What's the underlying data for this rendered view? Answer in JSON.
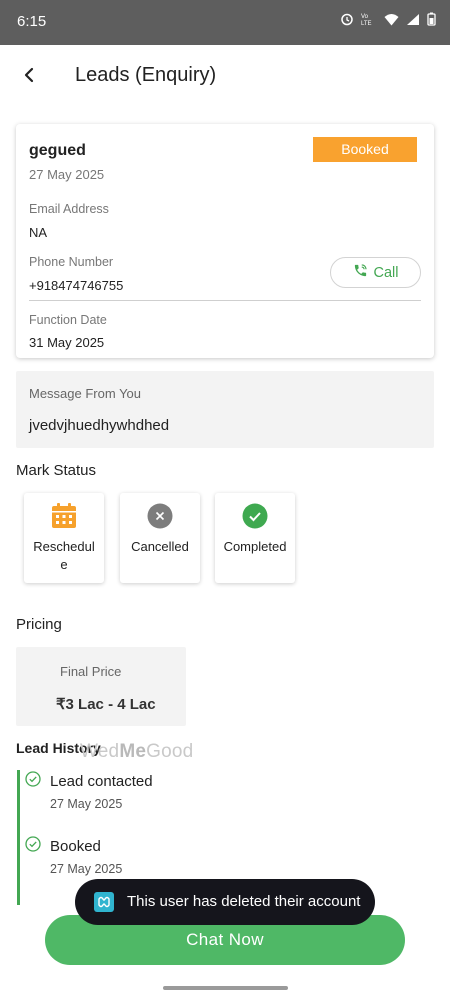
{
  "status_bar": {
    "time": "6:15"
  },
  "header": {
    "title": "Leads (Enquiry)"
  },
  "lead": {
    "name": "gegued",
    "date": "27 May 2025",
    "badge": "Booked",
    "email_label": "Email Address",
    "email_value": "NA",
    "phone_label": "Phone Number",
    "phone_value": "+918474746755",
    "call_label": "Call",
    "function_label": "Function Date",
    "function_value": "31 May 2025"
  },
  "message": {
    "label": "Message From You",
    "text": "jvedvjhuedhywhdhed"
  },
  "mark_status": {
    "title": "Mark Status",
    "options": [
      {
        "label_line1": "Reschedul",
        "label_line2": "e",
        "icon": "calendar-icon"
      },
      {
        "label_line1": "Cancelled",
        "label_line2": "",
        "icon": "cancel-icon"
      },
      {
        "label_line1": "Completed",
        "label_line2": "",
        "icon": "check-icon"
      }
    ]
  },
  "pricing": {
    "title": "Pricing",
    "label": "Final Price",
    "value": "₹3 Lac - 4 Lac"
  },
  "history": {
    "title": "Lead History",
    "items": [
      {
        "label": "Lead contacted",
        "date": "27 May 2025"
      },
      {
        "label": "Booked",
        "date": "27 May 2025"
      }
    ]
  },
  "watermark": {
    "part1": "Wed",
    "part2": "Me",
    "part3": "Good"
  },
  "toast": {
    "text": "This user has deleted their account"
  },
  "chat": {
    "label": "Chat Now"
  },
  "colors": {
    "accent_green": "#4fb866",
    "badge_orange": "#f9a22f",
    "toast_bg": "#15151c"
  }
}
